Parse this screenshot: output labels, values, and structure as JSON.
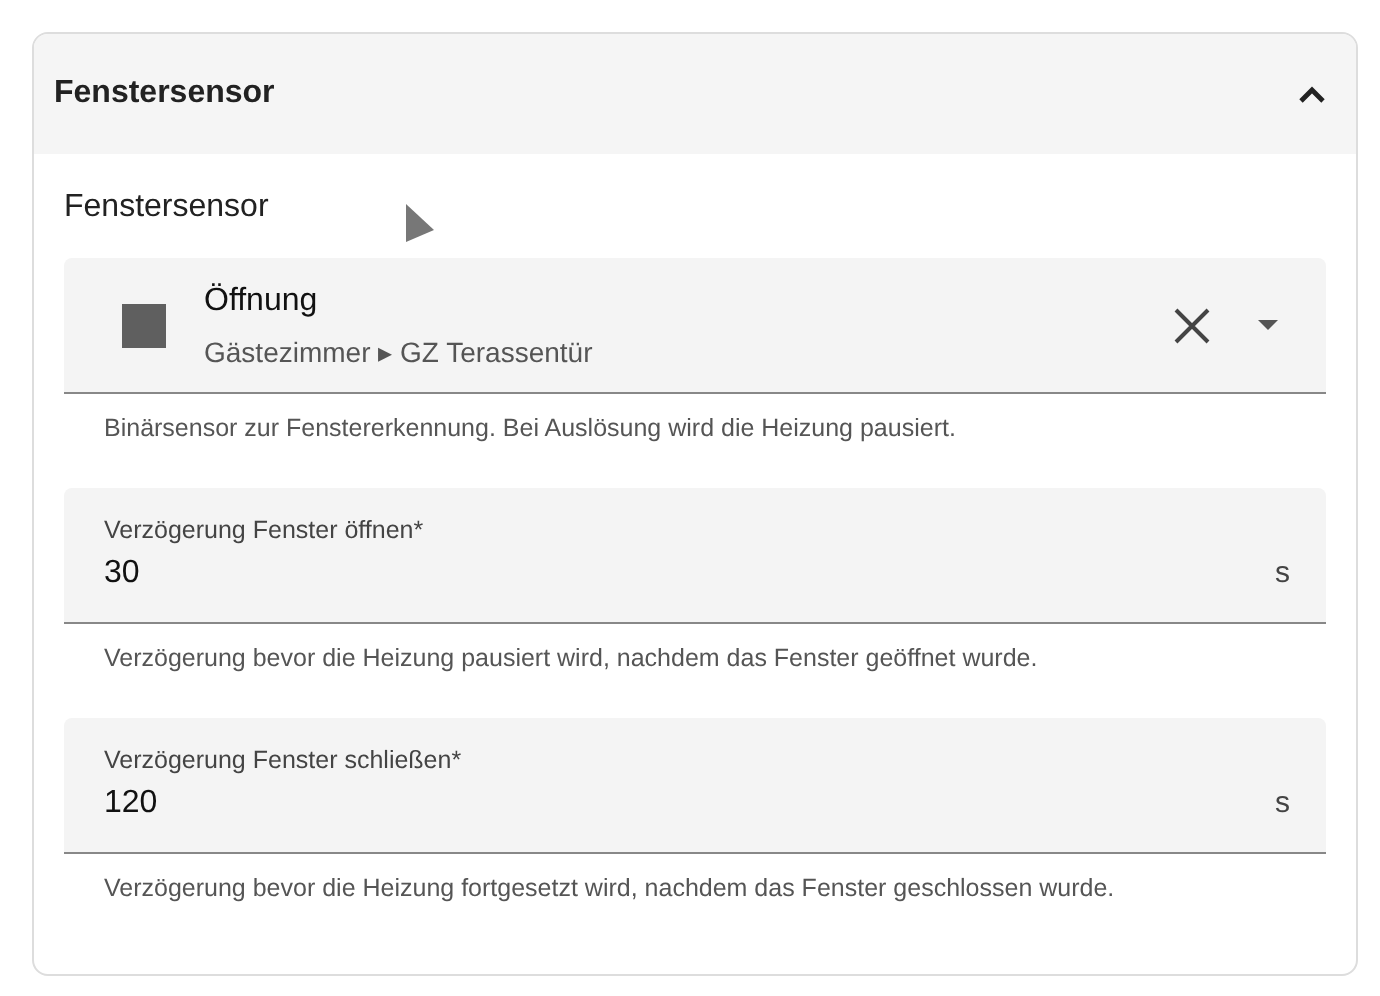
{
  "panel": {
    "title": "Fenstersensor",
    "expanded": true
  },
  "section_label": "Fenstersensor",
  "entity_picker": {
    "name": "Öffnung",
    "path": "Gästezimmer ▸ GZ Terassentür",
    "helper": "Binärsensor zur Fenstererkennung. Bei Auslösung wird die Heizung pausiert."
  },
  "fields": [
    {
      "label": "Verzögerung Fenster öffnen*",
      "value": "30",
      "suffix": "s",
      "helper": "Verzögerung bevor die Heizung pausiert wird, nachdem das Fenster geöffnet wurde."
    },
    {
      "label": "Verzögerung Fenster schließen*",
      "value": "120",
      "suffix": "s",
      "helper": "Verzögerung bevor die Heizung fortgesetzt wird, nachdem das Fenster geschlossen wurde."
    }
  ]
}
